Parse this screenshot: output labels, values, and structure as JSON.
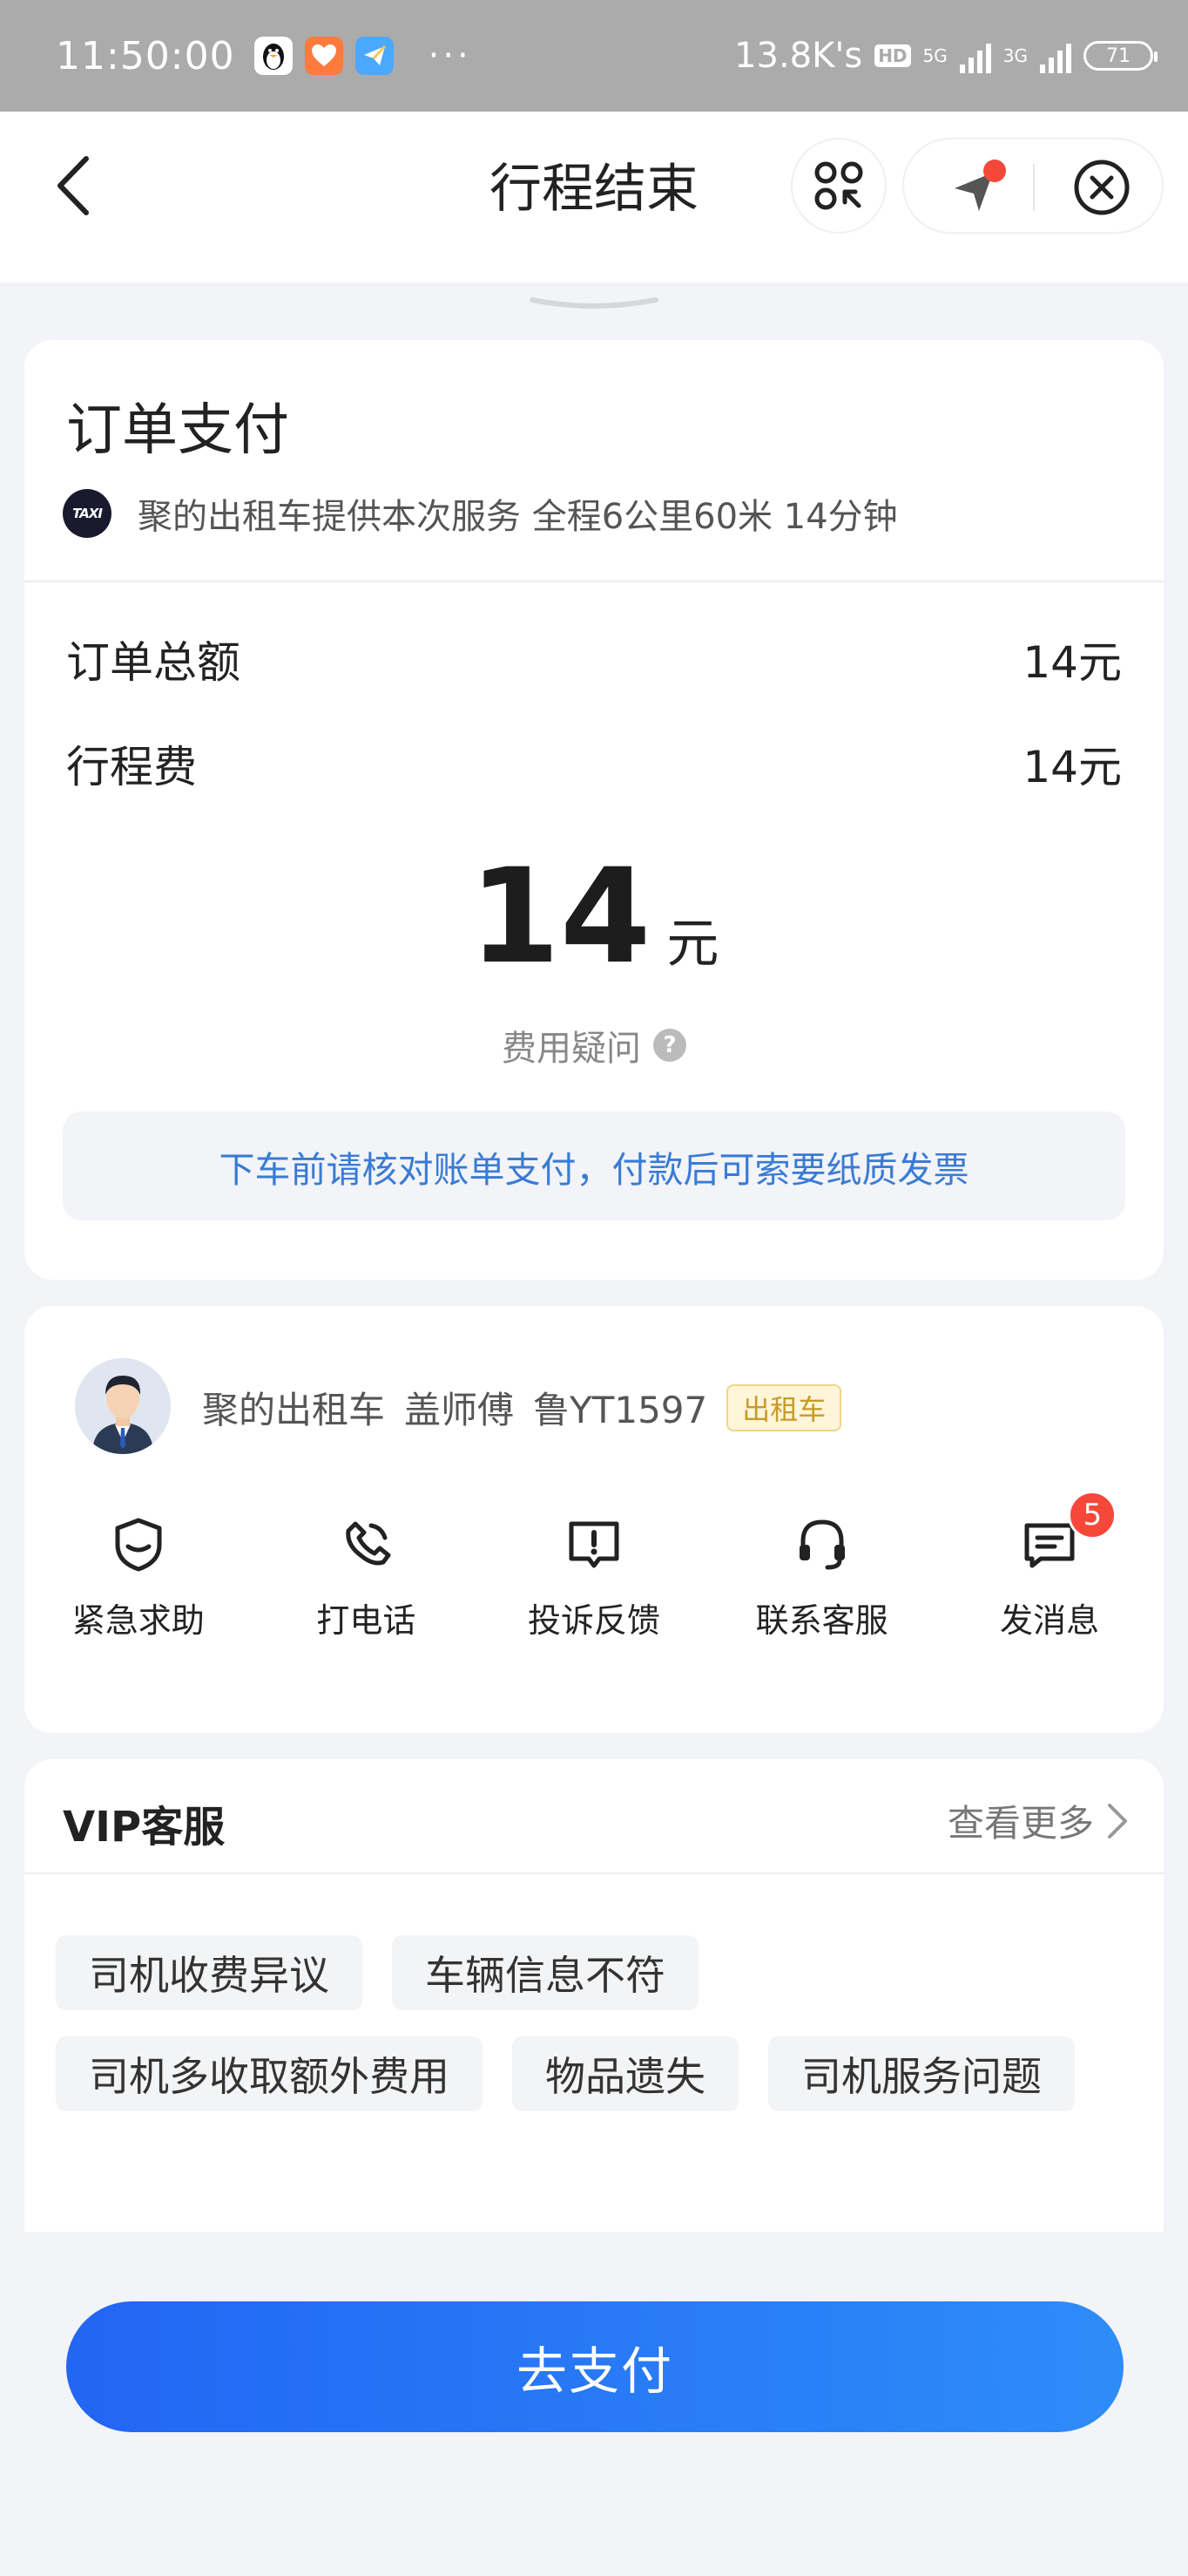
{
  "status_bar": {
    "time": "11:50:00",
    "more": "···",
    "speed": "13.8K's",
    "hd": "HD",
    "net1": "5G",
    "net2": "3G",
    "battery": "71"
  },
  "header": {
    "title": "行程结束"
  },
  "payment": {
    "title": "订单支付",
    "logo_text": "TAXI",
    "summary": "聚的出租车提供本次服务 全程6公里60米 14分钟",
    "rows": [
      {
        "label": "订单总额",
        "value": "14元"
      },
      {
        "label": "行程费",
        "value": "14元"
      }
    ],
    "amount": "14",
    "amount_unit": "元",
    "fee_question": "费用疑问",
    "question_icon": "?",
    "notice": "下车前请核对账单支付，付款后可索要纸质发票"
  },
  "driver": {
    "company": "聚的出租车",
    "name": "盖师傅",
    "plate": "鲁YT1597",
    "tag": "出租车",
    "actions": [
      {
        "label": "紧急求助",
        "icon": "shield-icon"
      },
      {
        "label": "打电话",
        "icon": "phone-icon"
      },
      {
        "label": "投诉反馈",
        "icon": "complaint-icon"
      },
      {
        "label": "联系客服",
        "icon": "headset-icon"
      },
      {
        "label": "发消息",
        "icon": "message-icon",
        "badge": "5"
      }
    ]
  },
  "vip": {
    "title": "VIP客服",
    "more": "查看更多",
    "chips": [
      "司机收费异议",
      "车辆信息不符",
      "司机多收取额外费用",
      "物品遗失",
      "司机服务问题"
    ]
  },
  "pay_button": "去支付",
  "colors": {
    "primary": "#2266f4",
    "notice_text": "#3a7bd5",
    "badge": "#f5483b",
    "tag": "#c89a28"
  }
}
